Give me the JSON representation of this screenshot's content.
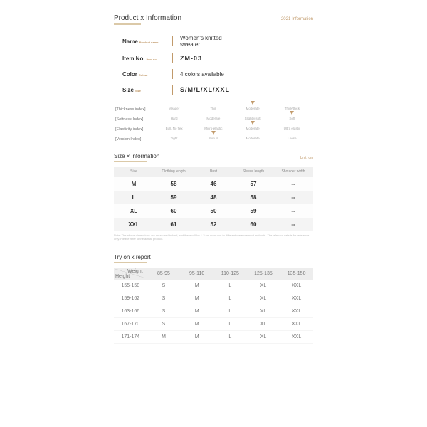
{
  "section_info_title": "Product x Information",
  "section_info_badge": "2021 Information",
  "info": {
    "name_lbl": "Name",
    "name_sub": "Product name",
    "name_val": "Women's knitted sweater",
    "item_lbl": "Item No.",
    "item_sub": "Item no.",
    "item_val": "ZM-03",
    "color_lbl": "Color",
    "color_sub": "Colour",
    "color_val": "4 colors available",
    "size_lbl": "Size",
    "size_sub": "Size",
    "size_val": "S/M/L/XL/XXL"
  },
  "indices": [
    {
      "label": "[Thickness index]",
      "opts": [
        "Meager",
        "Thin",
        "Moderate",
        "Thick/thick"
      ],
      "sel": 2
    },
    {
      "label": "[Softness Index]",
      "opts": [
        "Hard",
        "Moderate",
        "Slightly soft",
        "Soft"
      ],
      "sel": 3
    },
    {
      "label": "[Elasticity index]",
      "opts": [
        "Bull. No flex",
        "Micro-elastic",
        "Moderate",
        "Ultra elastic"
      ],
      "sel": 2
    },
    {
      "label": "[Version Index]",
      "opts": [
        "Tight",
        "Slim fit",
        "Moderate",
        "Loose"
      ],
      "sel": 1
    }
  ],
  "size_sec_title": "Size × information",
  "size_unit": "Unit: cm",
  "size_headers": [
    "Size",
    "Clothing length",
    "Bust",
    "Sleeve length",
    "Shoulder width"
  ],
  "size_rows": [
    [
      "M",
      "58",
      "46",
      "57",
      "--"
    ],
    [
      "L",
      "59",
      "48",
      "58",
      "--"
    ],
    [
      "XL",
      "60",
      "50",
      "59",
      "--"
    ],
    [
      "XXL",
      "61",
      "52",
      "60",
      "--"
    ]
  ],
  "size_note": "Note: The above dimensions are measured in kind, and there will be 1-3 cm error due to different measurement methods. The relevant data is for reference only. Please refer to the actual product.",
  "try_sec_title": "Try on x report",
  "try_weight_lbl": "Weight",
  "try_height_lbl": "Height",
  "try_cols": [
    "85-95",
    "95-110",
    "110-125",
    "125-135",
    "135-150"
  ],
  "try_rows": [
    [
      "155-158",
      "S",
      "M",
      "L",
      "XL",
      "XXL"
    ],
    [
      "159-162",
      "S",
      "M",
      "L",
      "XL",
      "XXL"
    ],
    [
      "163-166",
      "S",
      "M",
      "L",
      "XL",
      "XXL"
    ],
    [
      "167-170",
      "S",
      "M",
      "L",
      "XL",
      "XXL"
    ],
    [
      "171-174",
      "M",
      "M",
      "L",
      "XL",
      "XXL"
    ]
  ]
}
